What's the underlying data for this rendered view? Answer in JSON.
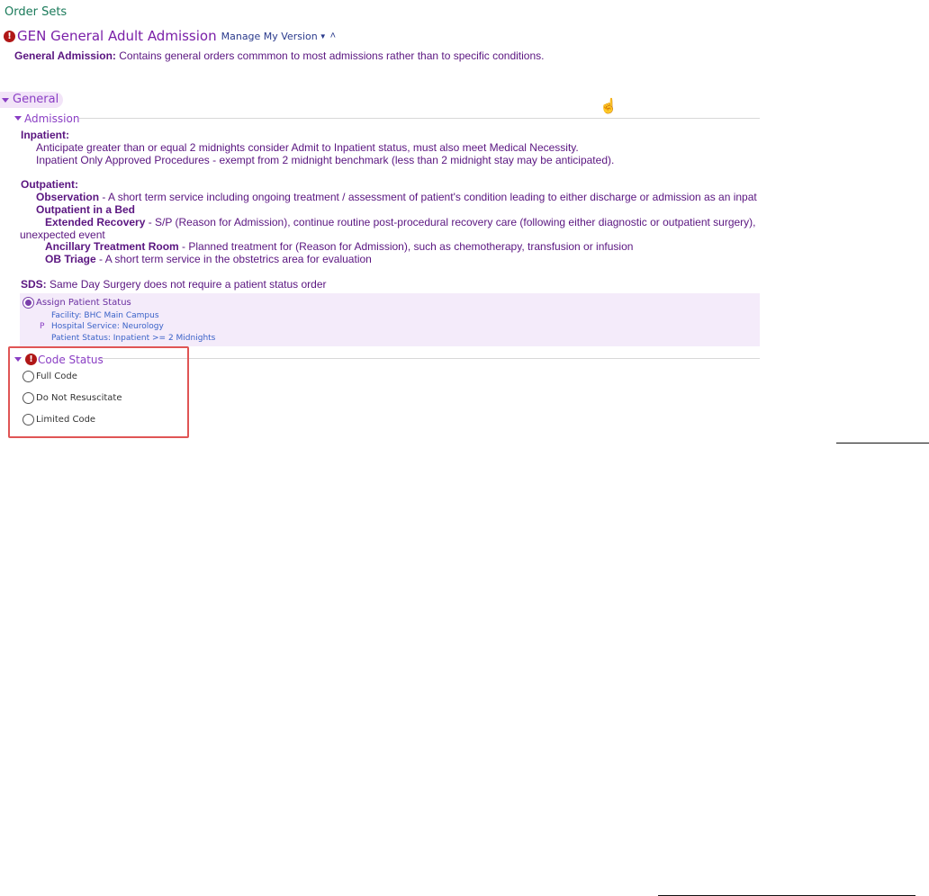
{
  "breadcrumb": "Order Sets",
  "order_set": {
    "title": "GEN General Adult Admission",
    "manage_link": "Manage My Version",
    "description_label": "General Admission:",
    "description_text": " Contains general orders commmon to most admissions rather than to specific conditions."
  },
  "sections": {
    "general": "General",
    "admission": "Admission",
    "code_status": "Code Status"
  },
  "admission_text": {
    "inpatient_heading": "Inpatient:",
    "inpatient_line1": "Anticipate greater than or equal 2 midnights consider Admit to Inpatient status, must also meet Medical Necessity.",
    "inpatient_line2": "Inpatient Only Approved Procedures - exempt from 2 midnight benchmark (less than 2 midnight stay may be anticipated).",
    "outpatient_heading": "Outpatient:",
    "observation_label": "Observation",
    "observation_text": " - A short term service including ongoing treatment / assessment of patient's condition leading to either discharge or admission as an inpat",
    "outpatient_bed_heading": "Outpatient in a Bed",
    "extended_label": "Extended Recovery",
    "extended_text": " - S/P (Reason for Admission), continue routine post-procedural recovery care (following either diagnostic or outpatient surgery),",
    "extended_wrap": "unexpected event",
    "ancillary_label": "Ancillary Treatment Room",
    "ancillary_text": " - Planned treatment for (Reason for Admission), such as chemotherapy, transfusion or infusion",
    "ob_label": "OB Triage",
    "ob_text": " - A short term service in the obstetrics area for evaluation",
    "sds_label": "SDS:",
    "sds_text": "  Same Day Surgery does not require a patient status order"
  },
  "assign_status": {
    "label": "Assign Patient Status",
    "marker": "P",
    "facility": "Facility: BHC Main Campus",
    "service": "Hospital Service: Neurology",
    "status": "Patient Status: Inpatient >= 2 Midnights"
  },
  "code_status_options": [
    "Full Code",
    "Do Not Resuscitate",
    "Limited Code"
  ],
  "colors": {
    "accent": "#8a3ec4",
    "text": "#5a1580",
    "link": "#3a62c8",
    "error": "#b01717",
    "highlight": "#e05555"
  },
  "icons": {
    "error": "exclamation-circle-icon",
    "collapse": "double-chevron-up-icon",
    "cursor": "hand-pointer-icon"
  }
}
